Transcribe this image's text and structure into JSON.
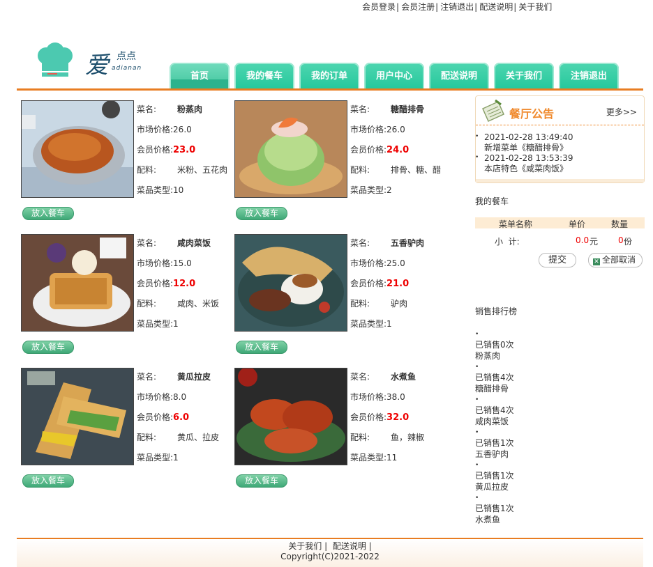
{
  "top_links": [
    "会员登录",
    "会员注册",
    "注销退出",
    "配送说明",
    "关于我们"
  ],
  "logo": {
    "main": "爱",
    "small": "点点",
    "en": "adianan"
  },
  "nav": [
    "首页",
    "我的餐车",
    "我的订单",
    "用户中心",
    "配送说明",
    "关于我们",
    "注销退出"
  ],
  "labels": {
    "name": "菜名:",
    "market": "市场价格:",
    "member": "会员价格:",
    "ingredients": "配料:",
    "type": "菜品类型:",
    "add": "放入餐车"
  },
  "dishes": [
    {
      "name": "粉蒸肉",
      "market": "26.0",
      "member": "23.0",
      "ingredients": "米粉、五花肉",
      "type": "10"
    },
    {
      "name": "糖醋排骨",
      "market": "26.0",
      "member": "24.0",
      "ingredients": "排骨、糖、醋",
      "type": "2"
    },
    {
      "name": "咸肉菜饭",
      "market": "15.0",
      "member": "12.0",
      "ingredients": "咸肉、米饭",
      "type": "1"
    },
    {
      "name": "五香驴肉",
      "market": "25.0",
      "member": "21.0",
      "ingredients": "驴肉",
      "type": "1"
    },
    {
      "name": "黄瓜拉皮",
      "market": "8.0",
      "member": "6.0",
      "ingredients": "黄瓜、拉皮",
      "type": "1"
    },
    {
      "name": "水煮鱼",
      "market": "38.0",
      "member": "32.0",
      "ingredients": "鱼，辣椒",
      "type": "11"
    }
  ],
  "notice": {
    "title": "餐厅公告",
    "more": "更多>>",
    "items": [
      {
        "date": "2021-02-28 13:49:40",
        "text": "新增菜单《糖醋排骨》"
      },
      {
        "date": "2021-02-28 13:53:39",
        "text": "本店特色《咸菜肉饭》"
      }
    ]
  },
  "cart": {
    "title": "我的餐车",
    "col_name": "菜单名称",
    "col_price": "单价",
    "col_qty": "数量",
    "subtotal_label": "小  计:",
    "subtotal_value": "0.0",
    "subtotal_unit": "元",
    "count_value": "0",
    "count_unit": "份",
    "submit": "提交",
    "clear": "全部取消"
  },
  "rank": {
    "title": "销售排行榜",
    "items": [
      {
        "sold": "已销售0次",
        "name": "粉蒸肉"
      },
      {
        "sold": "已销售4次",
        "name": "糖醋排骨"
      },
      {
        "sold": "已销售4次",
        "name": "咸肉菜饭"
      },
      {
        "sold": "已销售1次",
        "name": "五香驴肉"
      },
      {
        "sold": "已销售1次",
        "name": "黄瓜拉皮"
      },
      {
        "sold": "已销售1次",
        "name": "水煮鱼"
      }
    ]
  },
  "footer": {
    "links": [
      "关于我们",
      "配送说明"
    ],
    "copyright": "Copyright(C)2021-2022"
  },
  "colors": {
    "accent": "#e87d22",
    "nav": "#23c79b",
    "price": "#ee0000"
  }
}
